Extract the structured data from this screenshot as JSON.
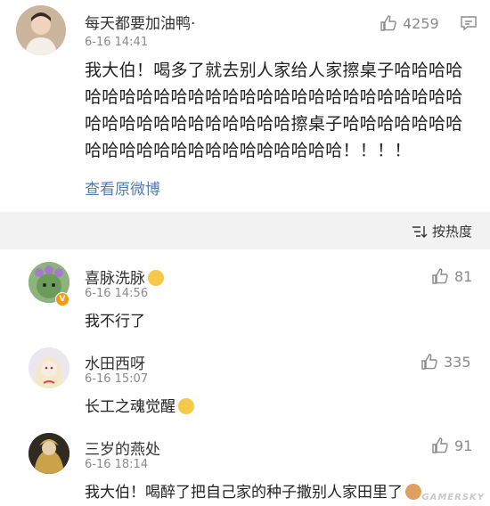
{
  "post": {
    "username": "每天都要加油鸭·",
    "time": "6-16 14:41",
    "likes": "4259",
    "text": "我大伯！喝多了就去别人家给人家擦桌子哈哈哈哈哈哈哈哈哈哈哈哈哈哈哈哈哈哈哈哈哈哈哈哈哈哈哈哈哈哈哈哈哈哈哈哈哈哈擦桌子哈哈哈哈哈哈哈哈哈哈哈哈哈哈哈哈哈哈哈哈哈哈！！！！",
    "source_link": "查看原微博"
  },
  "sort": {
    "label": "按热度"
  },
  "comments": [
    {
      "username": "喜脉洗脉",
      "time": "6-16 14:56",
      "likes": "81",
      "text": "我不行了"
    },
    {
      "username": "水田西呀",
      "time": "6-16 15:07",
      "likes": "335",
      "text": "长工之魂觉醒"
    },
    {
      "username": "三岁的燕处",
      "time": "6-16 18:14",
      "likes": "91",
      "text": "我大伯！喝醉了把自己家的种子撒别人家田里了"
    }
  ],
  "watermark": "GAMERSKY",
  "colors": {
    "link": "#507daf",
    "divider": "#f2f2f2",
    "muted": "#8a8a8a"
  }
}
